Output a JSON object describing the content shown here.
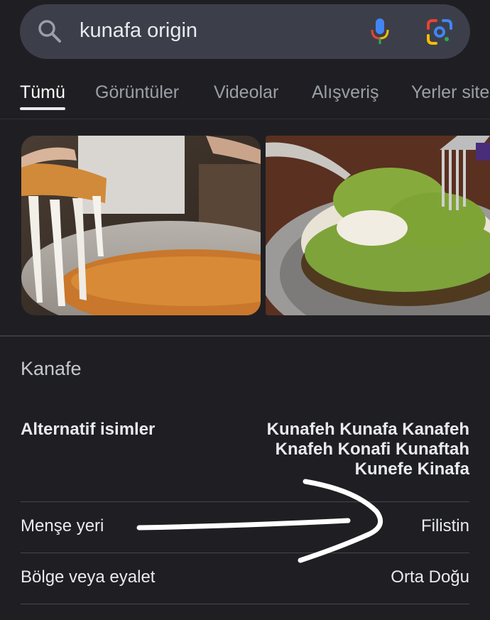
{
  "search": {
    "query": "kunafa origin"
  },
  "tabs": [
    {
      "label": "Tümü"
    },
    {
      "label": "Görüntüler"
    },
    {
      "label": "Videolar"
    },
    {
      "label": "Alışveriş"
    },
    {
      "label": "Yerler site"
    }
  ],
  "entity": {
    "title": "Kanafe",
    "rows": [
      {
        "label": "Alternatif isimler",
        "value_lines": [
          "Kunafeh Kunafa Kanafeh",
          "Knafeh Konafi Kunaftah",
          "Kunefe Kinafa"
        ]
      },
      {
        "label": "Menşe yeri",
        "value": "Filistin"
      },
      {
        "label": "Bölge veya eyalet",
        "value": "Orta Doğu"
      }
    ]
  },
  "colors": {
    "background": "#1f1f23",
    "search_bar": "#3c3f4a",
    "annotation_arrow": "#ffffff"
  }
}
